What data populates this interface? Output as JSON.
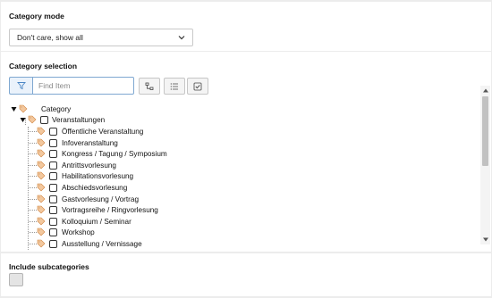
{
  "category_mode": {
    "title": "Category mode",
    "selected": "Don't care, show all"
  },
  "category_selection": {
    "title": "Category selection",
    "search": {
      "placeholder": "Find Item"
    },
    "root_label": "Category",
    "parent_label": "Veranstaltungen",
    "children": [
      "Öffentliche Veranstaltung",
      "Infoveranstaltung",
      "Kongress / Tagung / Symposium",
      "Antrittsvorlesung",
      "Habilitationsvorlesung",
      "Abschiedsvorlesung",
      "Gastvorlesung / Vortrag",
      "Vortragsreihe / Ringvorlesung",
      "Kolloquium / Seminar",
      "Workshop",
      "Ausstellung / Vernissage"
    ]
  },
  "include_subcategories": {
    "title": "Include subcategories"
  },
  "colors": {
    "tag_icon": "#e09a5a",
    "filter_blue": "#7fa8d1"
  }
}
